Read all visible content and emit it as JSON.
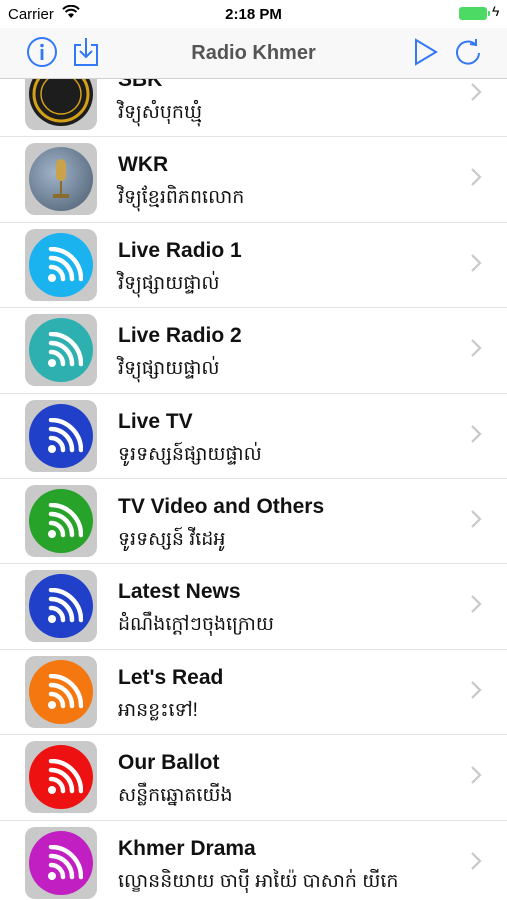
{
  "status_bar": {
    "carrier": "Carrier",
    "time": "2:18 PM"
  },
  "nav": {
    "title": "Radio Khmer"
  },
  "colors": {
    "accent": "#3478f6",
    "chevron": "#c7c7cc"
  },
  "stations": [
    {
      "name": "SBK",
      "subtitle": "វិទ្យុសំបុកឃ្មុំ",
      "icon": "sbk-logo-icon",
      "color": "#222222"
    },
    {
      "name": "WKR",
      "subtitle": "វិទ្យុខ្មែរពិភពលោក",
      "icon": "globe-microphone-icon",
      "color": "#556677"
    },
    {
      "name": "Live Radio 1",
      "subtitle": "វិទ្យុផ្សាយផ្ទាល់",
      "icon": "radio-signal-icon",
      "color": "#1ab3f0"
    },
    {
      "name": "Live Radio 2",
      "subtitle": "វិទ្យុផ្សាយផ្ទាល់",
      "icon": "radio-signal-icon",
      "color": "#2fb0b0"
    },
    {
      "name": "Live TV",
      "subtitle": "ទូរទស្សន៍ផ្សាយផ្ទាល់",
      "icon": "radio-signal-icon",
      "color": "#2140c9"
    },
    {
      "name": "TV Video and Others",
      "subtitle": "ទូរទស្សន៍ វីដេអូ",
      "icon": "radio-signal-icon",
      "color": "#27a32a"
    },
    {
      "name": "Latest News",
      "subtitle": "ដំណឹងក្តៅៗចុងក្រោយ",
      "icon": "radio-signal-icon",
      "color": "#2140c9"
    },
    {
      "name": "Let's Read",
      "subtitle": "អានខ្លះទៅ!",
      "icon": "radio-signal-icon",
      "color": "#f5770f"
    },
    {
      "name": "Our Ballot",
      "subtitle": "សន្លឹកឆ្នោតយើង",
      "icon": "radio-signal-icon",
      "color": "#ee1111"
    },
    {
      "name": "Khmer Drama",
      "subtitle": "ល្ខោននិយាយ ចាប៉ី អាយ៉ៃ បាសាក់ យីកេ",
      "icon": "radio-signal-icon",
      "color": "#c21fc2"
    }
  ]
}
